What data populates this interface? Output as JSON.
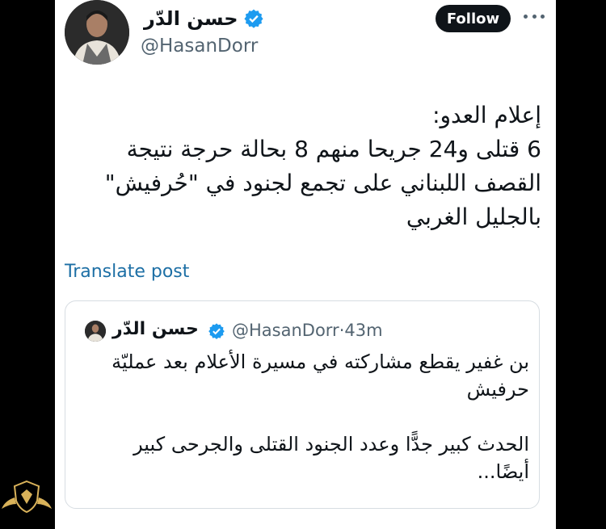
{
  "author": {
    "name": "حسن الدّر",
    "handle": "@HasanDorr",
    "avatar_icon": "avatar-photo",
    "verified_icon": "verified-badge-icon"
  },
  "actions": {
    "follow_label": "Follow",
    "more_icon": "more-options-icon"
  },
  "tweet": {
    "lines": [
      "إعلام العدو:",
      "6 قتلى و24 جريحا منهم 8 بحالة حرجة نتيجة",
      "القصف اللبناني على تجمع لجنود في \"حُرفيش\"",
      "بالجليل الغربي"
    ],
    "translate_label": "Translate post"
  },
  "quote": {
    "name": "حسن الدّر",
    "handle": "@HasanDorr",
    "separator": "·",
    "time": "43m",
    "lines": [
      "بن غفير يقطع مشاركته في مسيرة الأعلام بعد عمليّة",
      "حرفيش",
      "",
      "الحدث كبير جدًّا وعدد الجنود القتلى والجرحى كبير",
      "أيضًا..."
    ]
  },
  "colors": {
    "text": "#0f1419",
    "secondary": "#536471",
    "link": "#1d6fa5",
    "verified": "#1d9bf0",
    "follow_bg": "#0f1419"
  }
}
